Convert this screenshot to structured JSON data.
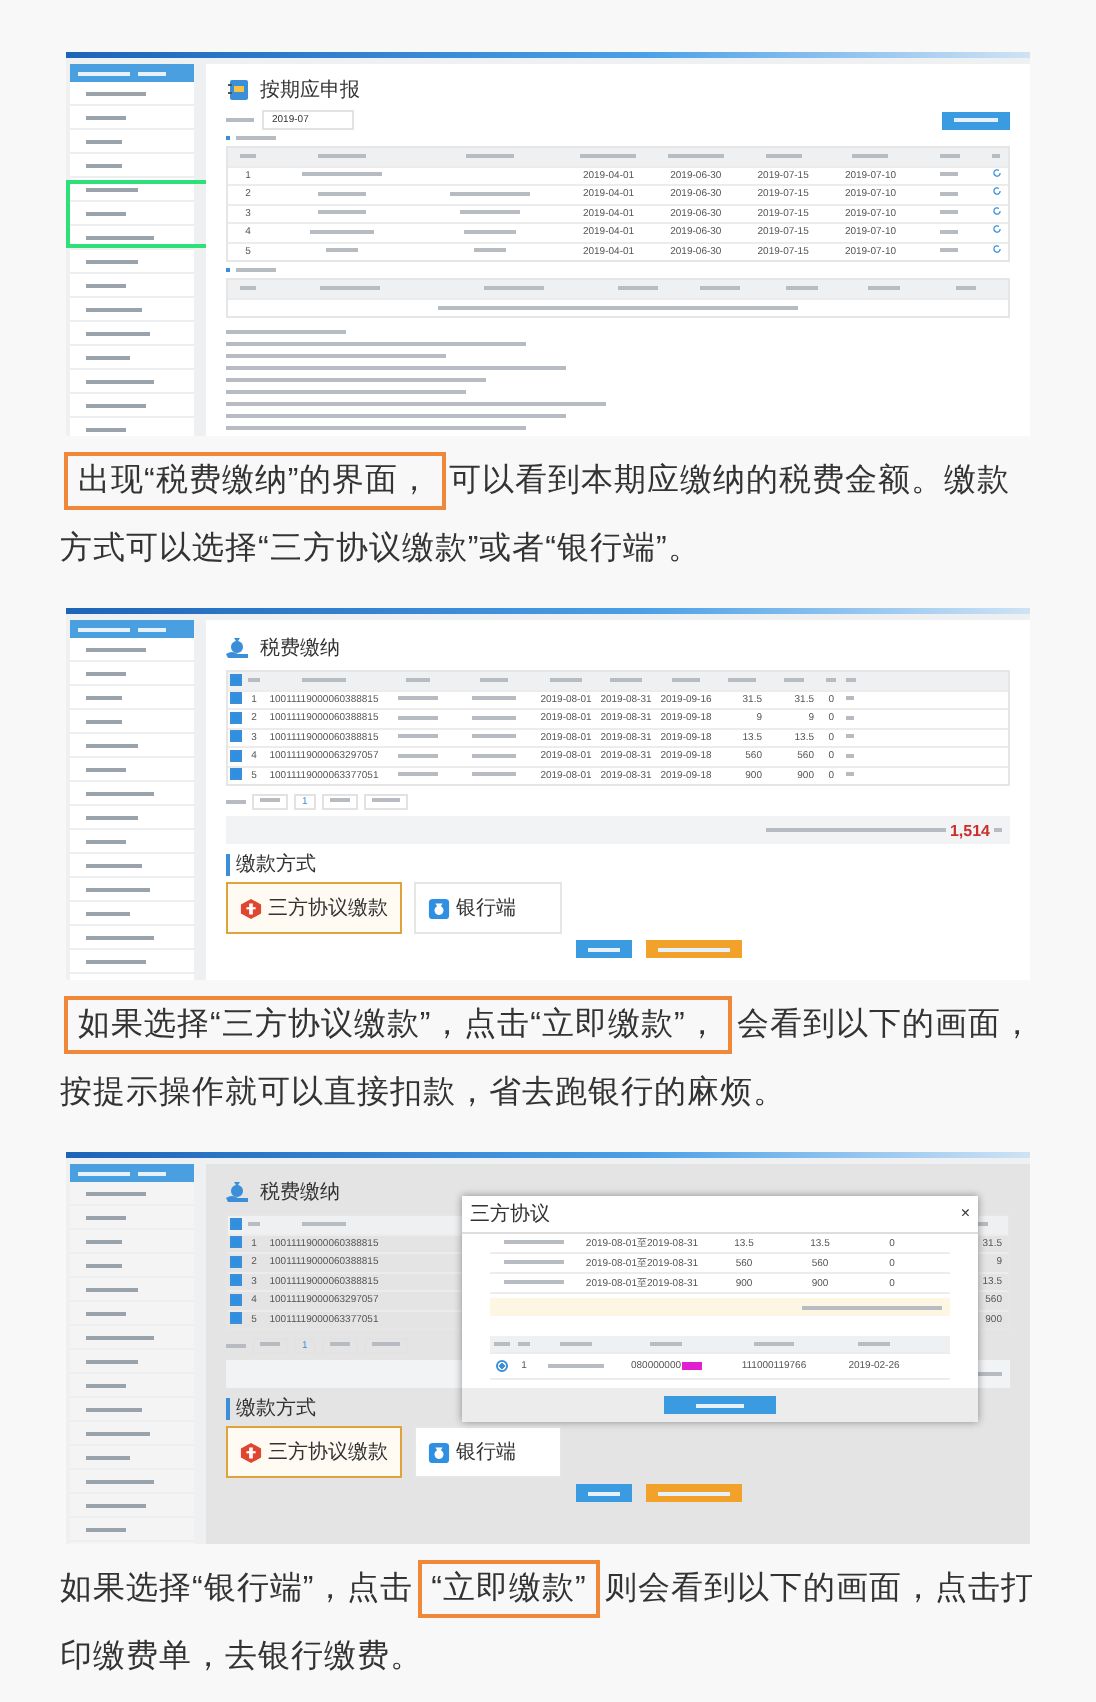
{
  "content": [
    {
      "kind": "declaration_screen",
      "title": "按期应申报",
      "period": "2019-07",
      "highlight_box": true,
      "rows": [
        {
          "no": "1",
          "start": "2019-04-01",
          "end": "2019-06-30",
          "deadline": "2019-07-15",
          "date": "2019-07-10"
        },
        {
          "no": "2",
          "start": "2019-04-01",
          "end": "2019-06-30",
          "deadline": "2019-07-15",
          "date": "2019-07-10"
        },
        {
          "no": "3",
          "start": "2019-04-01",
          "end": "2019-06-30",
          "deadline": "2019-07-15",
          "date": "2019-07-10"
        },
        {
          "no": "4",
          "start": "2019-04-01",
          "end": "2019-06-30",
          "deadline": "2019-07-15",
          "date": "2019-07-10"
        },
        {
          "no": "5",
          "start": "2019-04-01",
          "end": "2019-06-30",
          "deadline": "2019-07-15",
          "date": "2019-07-10"
        }
      ]
    },
    {
      "kind": "paragraph",
      "segments": [
        {
          "text": "出现“税费缴纳”的界面，",
          "highlighted": true
        },
        {
          "text": "可以看到本期应缴纳的税费金额。缴款方式可以选择“三方协议缴款”或者“银行端”。",
          "highlighted": false
        }
      ]
    },
    {
      "kind": "payment_screen",
      "title": "税费缴纳",
      "all_checked": true,
      "rows": [
        {
          "checked": true,
          "no": "1",
          "voucher": "10011119000060388815",
          "start": "2019-08-01",
          "end": "2019-08-31",
          "due": "2019-09-16",
          "amount": "31.5",
          "paid": "31.5",
          "late_fee": "0"
        },
        {
          "checked": true,
          "no": "2",
          "voucher": "10011119000060388815",
          "start": "2019-08-01",
          "end": "2019-08-31",
          "due": "2019-09-18",
          "amount": "9",
          "paid": "9",
          "late_fee": "0"
        },
        {
          "checked": true,
          "no": "3",
          "voucher": "10011119000060388815",
          "start": "2019-08-01",
          "end": "2019-08-31",
          "due": "2019-09-18",
          "amount": "13.5",
          "paid": "13.5",
          "late_fee": "0"
        },
        {
          "checked": true,
          "no": "4",
          "voucher": "10011119000063297057",
          "start": "2019-08-01",
          "end": "2019-08-31",
          "due": "2019-09-18",
          "amount": "560",
          "paid": "560",
          "late_fee": "0"
        },
        {
          "checked": true,
          "no": "5",
          "voucher": "10011119000063377051",
          "start": "2019-08-01",
          "end": "2019-08-31",
          "due": "2019-09-18",
          "amount": "900",
          "paid": "900",
          "late_fee": "0"
        }
      ],
      "page": "1",
      "total": "1,514",
      "methods_title": "缴款方式",
      "methods": [
        {
          "label": "三方协议缴款",
          "selected": true
        },
        {
          "label": "银行端",
          "selected": false
        }
      ]
    },
    {
      "kind": "paragraph",
      "segments": [
        {
          "text": "如果选择“三方协议缴款”，点击“立即缴款”，",
          "highlighted": true
        },
        {
          "text": "会看到以下的画面，按提示操作就可以直接扣款，省去跑银行的麻烦。",
          "highlighted": false
        }
      ]
    },
    {
      "kind": "payment_dialog_screen",
      "title": "税费缴纳",
      "all_checked": true,
      "rows": [
        {
          "checked": true,
          "no": "1",
          "voucher": "10011119000060388815",
          "amount": "31.5"
        },
        {
          "checked": true,
          "no": "2",
          "voucher": "10011119000060388815",
          "amount": "9"
        },
        {
          "checked": true,
          "no": "3",
          "voucher": "10011119000060388815",
          "amount": "13.5"
        },
        {
          "checked": true,
          "no": "4",
          "voucher": "10011119000063297057",
          "amount": "560"
        },
        {
          "checked": true,
          "no": "5",
          "voucher": "10011119000063377051",
          "amount": "900"
        }
      ],
      "page": "1",
      "methods_title": "缴款方式",
      "methods": [
        {
          "label": "三方协议缴款",
          "selected": true
        },
        {
          "label": "银行端",
          "selected": false
        }
      ],
      "dialog": {
        "title": "三方协议",
        "close": "×",
        "items": [
          {
            "period": "2019-08-01至2019-08-31",
            "amount": "13.5",
            "paid": "13.5",
            "diff": "0"
          },
          {
            "period": "2019-08-01至2019-08-31",
            "amount": "560",
            "paid": "560",
            "diff": "0"
          },
          {
            "period": "2019-08-01至2019-08-31",
            "amount": "900",
            "paid": "900",
            "diff": "0"
          }
        ],
        "accounts": [
          {
            "selected": true,
            "no": "1",
            "account": "080000000",
            "agreement": "111000119766",
            "signed": "2019-02-26"
          }
        ]
      }
    },
    {
      "kind": "paragraph",
      "segments": [
        {
          "text": "如果选择“银行端”，点击",
          "highlighted": false
        },
        {
          "text": "“立即缴款”",
          "highlighted": true
        },
        {
          "text": "则会看到以下的画面，点击打印缴费单，去银行缴费。",
          "highlighted": false
        }
      ]
    }
  ]
}
